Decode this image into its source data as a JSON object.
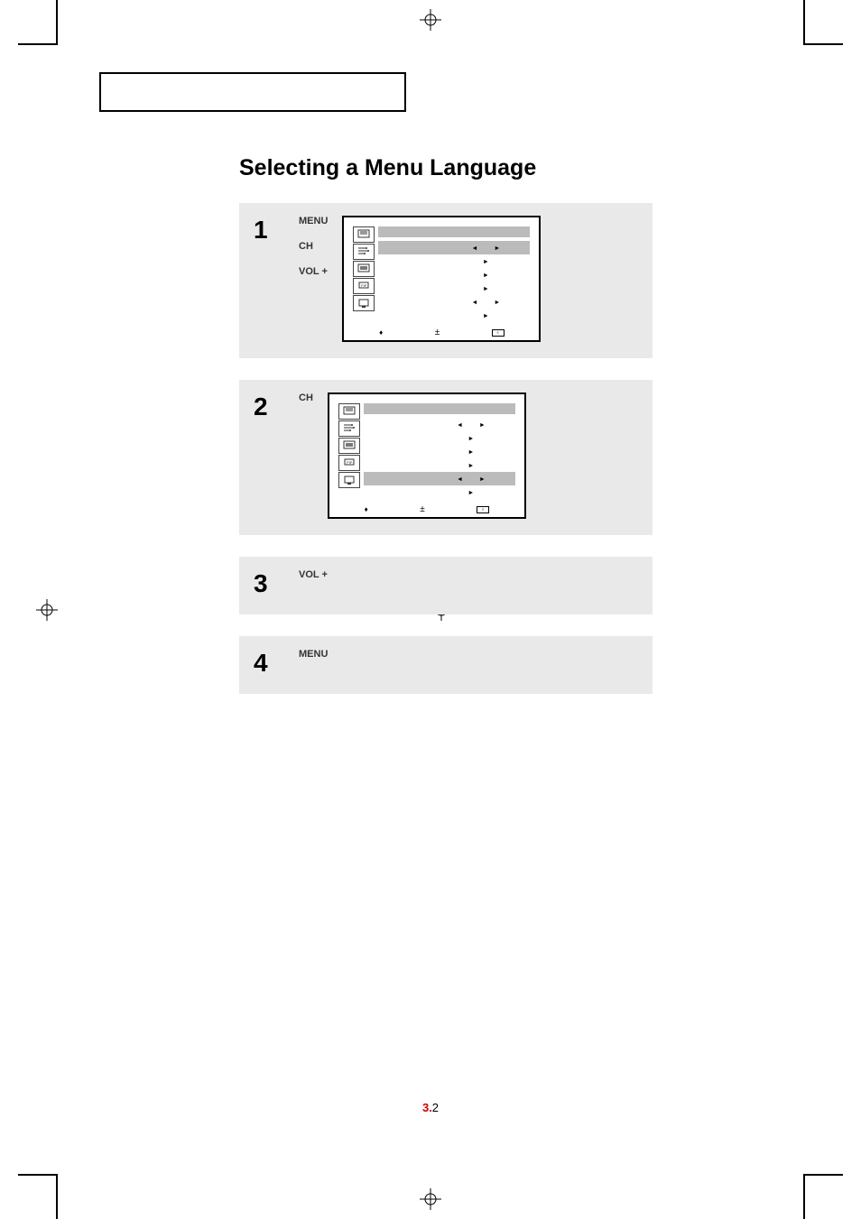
{
  "title": "Selecting a Menu Language",
  "page_number_prefix": "3.",
  "page_number_suffix": "2",
  "steps": [
    {
      "number": "1",
      "labels": [
        "MENU",
        "CH",
        "VOL +"
      ],
      "hasScreen": true,
      "highlightRow": 0,
      "menuRows": [
        {
          "arrows": [
            "left",
            "right"
          ]
        },
        {
          "arrows": [
            "right"
          ]
        },
        {
          "arrows": [
            "right"
          ]
        },
        {
          "arrows": [
            "right"
          ]
        },
        {
          "arrows": [
            "left",
            "right"
          ]
        },
        {
          "arrows": [
            "right"
          ]
        }
      ]
    },
    {
      "number": "2",
      "labels": [
        "CH"
      ],
      "hasScreen": true,
      "highlightRow": 4,
      "menuRows": [
        {
          "arrows": [
            "left",
            "right"
          ]
        },
        {
          "arrows": [
            "right"
          ]
        },
        {
          "arrows": [
            "right"
          ]
        },
        {
          "arrows": [
            "right"
          ]
        },
        {
          "arrows": [
            "left",
            "right"
          ]
        },
        {
          "arrows": [
            "right"
          ]
        }
      ]
    },
    {
      "number": "3",
      "labels": [
        "VOL +"
      ],
      "hasScreen": false
    },
    {
      "number": "4",
      "labels": [
        "MENU"
      ],
      "hasScreen": false
    }
  ],
  "tvFooter": {
    "move": "",
    "adjust": "",
    "menu": ""
  }
}
